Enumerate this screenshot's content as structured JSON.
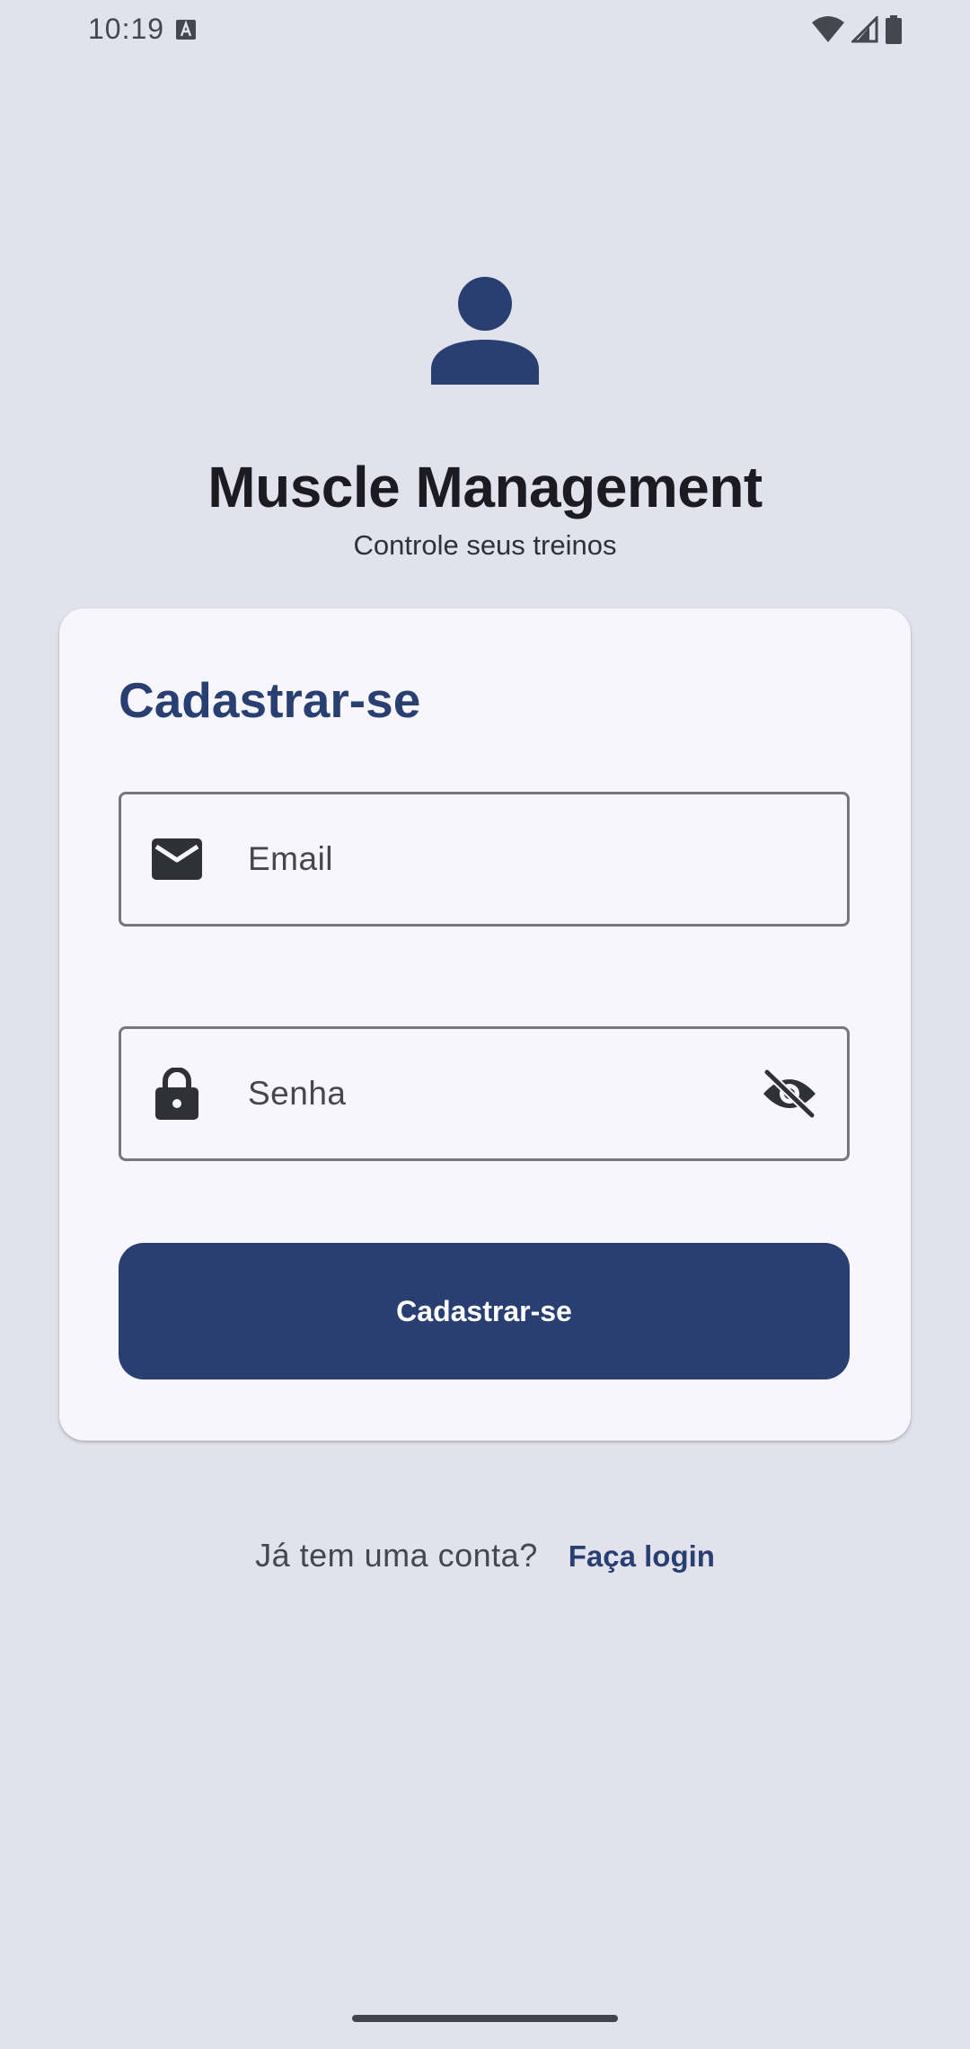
{
  "status_bar": {
    "time": "10:19"
  },
  "header": {
    "title": "Muscle Management",
    "subtitle": "Controle seus treinos",
    "avatar_icon": "person-icon"
  },
  "form": {
    "title": "Cadastrar-se",
    "email": {
      "label": "Email",
      "icon": "mail-icon",
      "value": ""
    },
    "password": {
      "label": "Senha",
      "icon": "lock-icon",
      "value": "",
      "visibility_icon": "visibility-off-icon"
    },
    "submit_label": "Cadastrar-se"
  },
  "footer": {
    "question": "Já tem uma conta?",
    "login_link": "Faça login"
  },
  "colors": {
    "background": "#e2e2ec",
    "card": "#f6f6fc",
    "primary": "#293f72",
    "on_surface": "#1b1b21",
    "outline": "#77767f"
  }
}
